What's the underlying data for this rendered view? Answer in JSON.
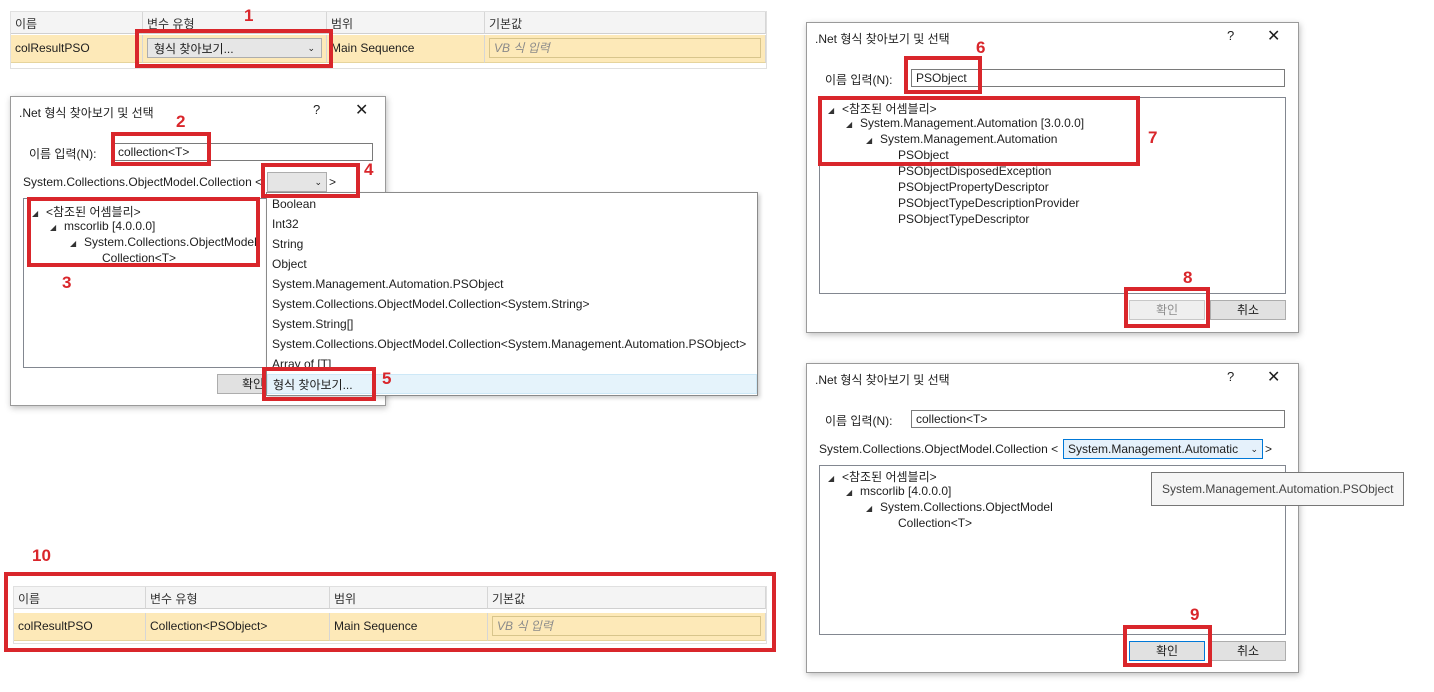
{
  "colors": {
    "annotation": "#d9262b",
    "row_bg": "#fde9b8",
    "header_bg": "#f4f4f4",
    "accent": "#0078d7"
  },
  "variables_top": {
    "headers": [
      "이름",
      "변수 유형",
      "범위",
      "기본값"
    ],
    "row": {
      "name": "colResultPSO",
      "type": "형식 찾아보기...",
      "scope": "Main Sequence",
      "default_placeholder": "VB 식 입력"
    }
  },
  "variables_bottom": {
    "headers": [
      "이름",
      "변수 유형",
      "범위",
      "기본값"
    ],
    "row": {
      "name": "colResultPSO",
      "type": "Collection<PSObject>",
      "scope": "Main Sequence",
      "default_placeholder": "VB 식 입력"
    }
  },
  "dialog_common": {
    "title": ".Net 형식 찾아보기 및 선택",
    "help": "?",
    "close": "✕",
    "name_label": "이름 입력(N):",
    "ok_label": "확인",
    "cancel_label": "취소",
    "ok_cut": "확인"
  },
  "dialog1": {
    "name_value": "collection<T>",
    "generic_prefix": "System.Collections.ObjectModel.Collection <",
    "generic_suffix": ">",
    "tree": {
      "root": "<참조된 어셈블리>",
      "assembly": "mscorlib [4.0.0.0]",
      "namespace": "System.Collections.ObjectModel",
      "type": "Collection<T>"
    },
    "dropdown_items": [
      "Boolean",
      "Int32",
      "String",
      "Object",
      "System.Management.Automation.PSObject",
      "System.Collections.ObjectModel.Collection<System.String>",
      "System.String[]",
      "System.Collections.ObjectModel.Collection<System.Management.Automation.PSObject>",
      "Array of [T]",
      "형식 찾아보기..."
    ]
  },
  "dialog2": {
    "name_value": "PSObject",
    "tree": {
      "root": "<참조된 어셈블리>",
      "assembly": "System.Management.Automation [3.0.0.0]",
      "namespace": "System.Management.Automation",
      "types": [
        "PSObject",
        "PSObjectDisposedException",
        "PSObjectPropertyDescriptor",
        "PSObjectTypeDescriptionProvider",
        "PSObjectTypeDescriptor"
      ]
    }
  },
  "dialog3": {
    "name_value": "collection<T>",
    "generic_prefix": "System.Collections.ObjectModel.Collection <",
    "generic_selected": "System.Management.Automatic",
    "generic_suffix": ">",
    "tooltip": "System.Management.Automation.PSObject",
    "tree": {
      "root": "<참조된 어셈블리>",
      "assembly": "mscorlib [4.0.0.0]",
      "namespace": "System.Collections.ObjectModel",
      "type": "Collection<T>"
    }
  },
  "steps": [
    "1",
    "2",
    "3",
    "4",
    "5",
    "6",
    "7",
    "8",
    "9",
    "10"
  ]
}
